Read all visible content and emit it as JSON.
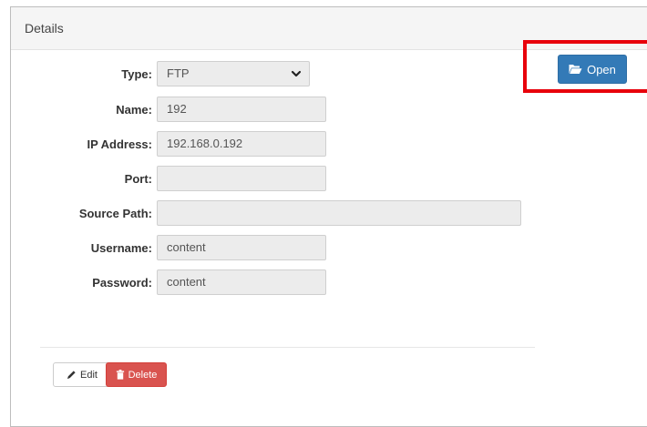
{
  "panel": {
    "title": "Details"
  },
  "form": {
    "type": {
      "label": "Type:",
      "value": "FTP"
    },
    "name": {
      "label": "Name:",
      "value": "192"
    },
    "ip_address": {
      "label": "IP Address:",
      "value": "192.168.0.192"
    },
    "port": {
      "label": "Port:",
      "value": ""
    },
    "source_path": {
      "label": "Source Path:",
      "value": ""
    },
    "username": {
      "label": "Username:",
      "value": "content"
    },
    "password": {
      "label": "Password:",
      "value": "content"
    }
  },
  "actions": {
    "open_label": "Open",
    "edit_label": "Edit",
    "delete_label": "Delete"
  },
  "colors": {
    "primary": "#337ab7",
    "danger": "#d9534f",
    "highlight": "#e8000b"
  }
}
